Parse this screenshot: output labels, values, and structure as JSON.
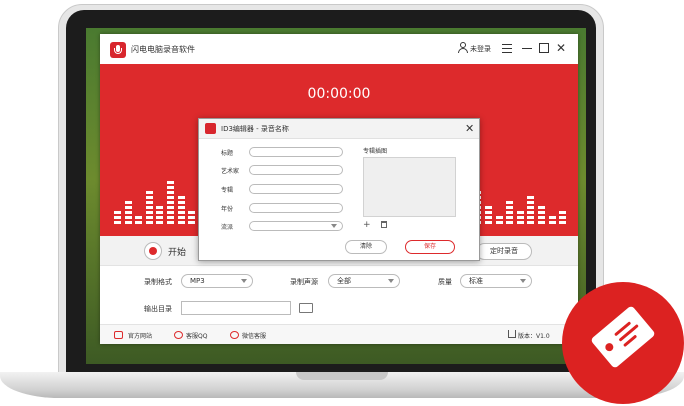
{
  "app": {
    "title": "闪电电脑录音软件",
    "login": "未登录",
    "timer": "00:00:00"
  },
  "controls": {
    "start": "开始",
    "timed_record": "定时录音"
  },
  "settings": {
    "format_label": "录制格式",
    "format_value": "MP3",
    "source_label": "录制声源",
    "source_value": "全部",
    "quality_label": "质量",
    "quality_value": "标准",
    "output_label": "输出目录"
  },
  "footer": {
    "website": "官方网站",
    "qq": "客服QQ",
    "wechat": "微信客服",
    "version": "版本：V1.0"
  },
  "dialog": {
    "title": "ID3编辑器 - 录音名称",
    "fields": [
      {
        "label": "标题"
      },
      {
        "label": "艺术家"
      },
      {
        "label": "专辑"
      },
      {
        "label": "年份"
      },
      {
        "label": "流派"
      }
    ],
    "cover_label": "专辑插图",
    "cover_add": "+",
    "clear": "清除",
    "save": "保存"
  },
  "colors": {
    "brand_red": "#dd2a2c",
    "badge_red": "#dc2221"
  },
  "icons": [
    "microphone-logo-icon",
    "user-icon",
    "menu-icon",
    "minimize-icon",
    "maximize-icon",
    "close-icon",
    "folder-icon",
    "home-icon",
    "qq-icon",
    "wechat-icon",
    "download-icon",
    "tag-icon",
    "plus-icon",
    "trash-icon"
  ]
}
